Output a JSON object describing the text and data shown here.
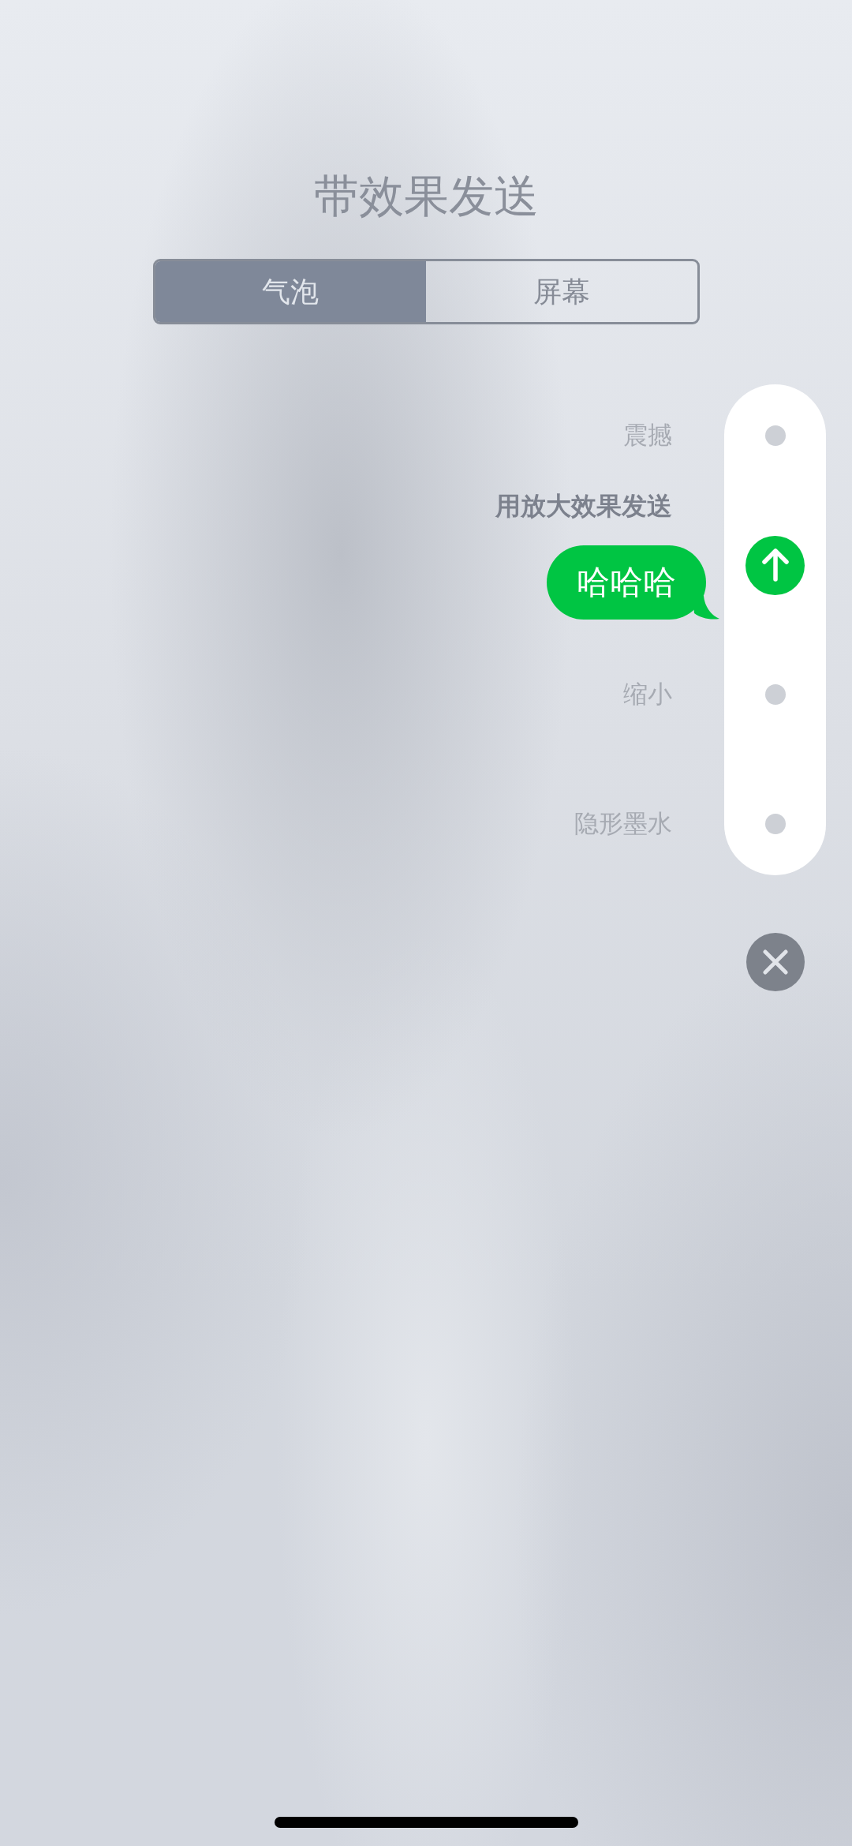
{
  "title": "带效果发送",
  "tabs": [
    {
      "label": "气泡",
      "selected": true
    },
    {
      "label": "屏幕",
      "selected": false
    }
  ],
  "effects": [
    {
      "label": "震撼",
      "selected": false
    },
    {
      "label": "用放大效果发送",
      "selected": true
    },
    {
      "label": "缩小",
      "selected": false
    },
    {
      "label": "隐形墨水",
      "selected": false
    }
  ],
  "message": {
    "text": "哈哈哈"
  }
}
